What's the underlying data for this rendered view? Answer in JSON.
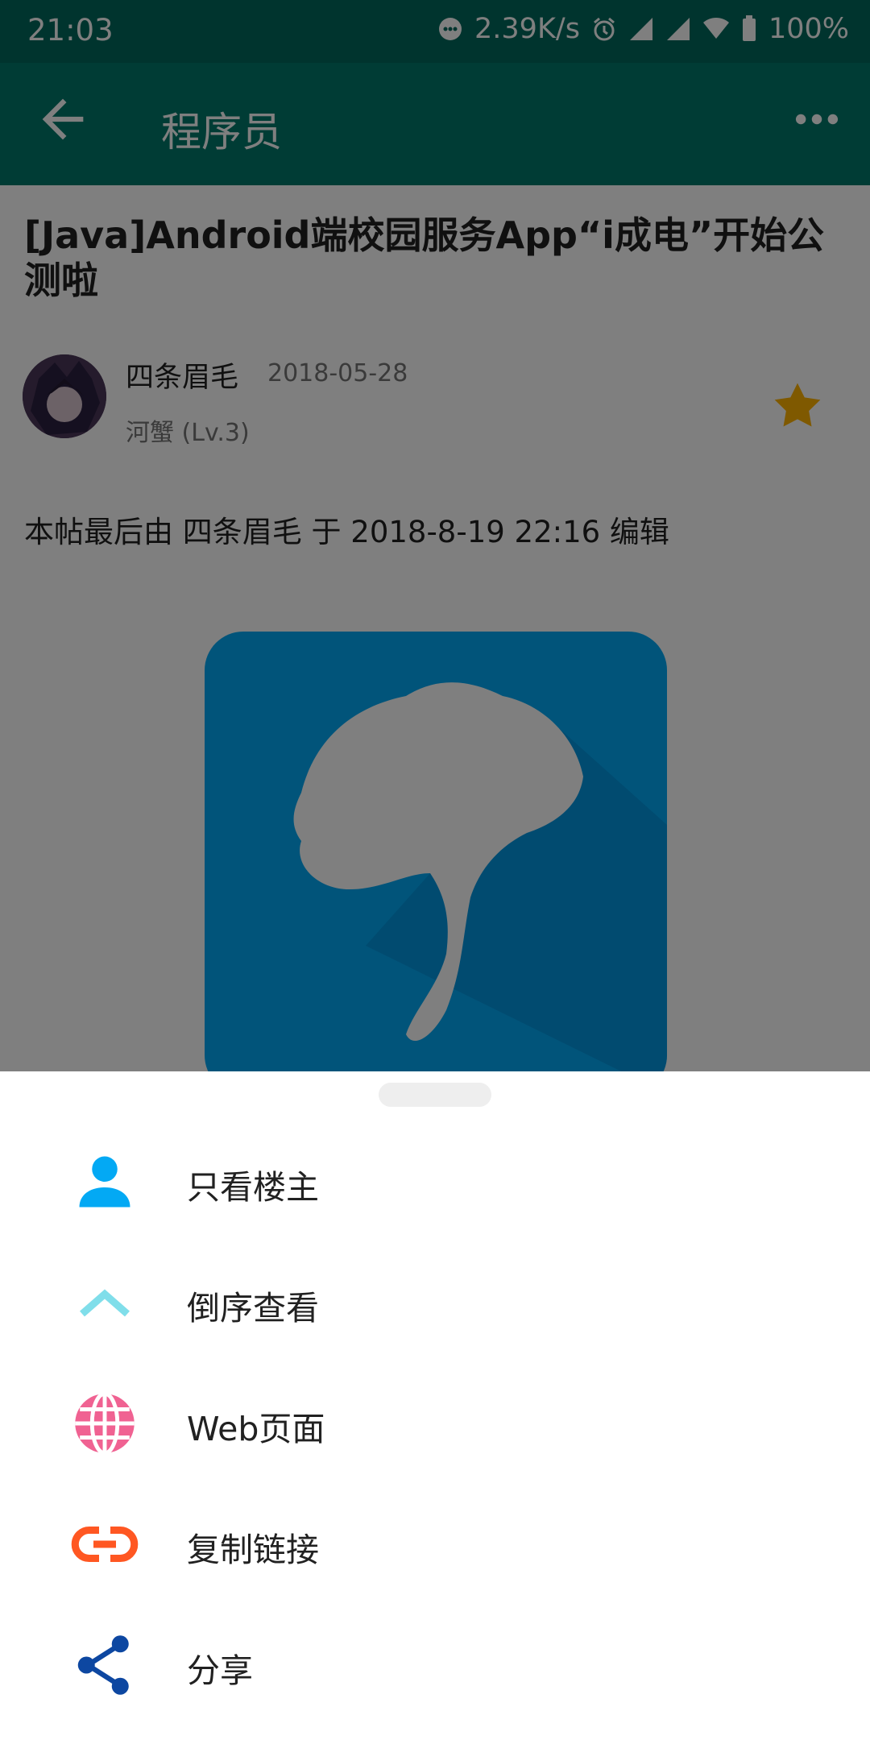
{
  "status_bar": {
    "time": "21:03",
    "net_speed": "2.39K/s",
    "battery": "100%",
    "icons": [
      "message-icon",
      "alarm-icon",
      "signal-icon",
      "signal-icon",
      "wifi-icon",
      "battery-icon"
    ]
  },
  "app_bar": {
    "title": "程序员",
    "back_icon": "arrow-back-icon",
    "more_icon": "more-horizontal-icon"
  },
  "post": {
    "title": "[Java]Android端校园服务App“i成电”开始公测啦",
    "author": "四条眉毛",
    "date": "2018-05-28",
    "level": "河蟹 (Lv.3)",
    "edit_note": "本帖最后由 四条眉毛 于 2018-8-19 22:16 编辑",
    "star_color": "#ffb300"
  },
  "sheet": {
    "items": [
      {
        "label": "只看楼主",
        "icon": "person-icon",
        "color": "#03a9f4"
      },
      {
        "label": "倒序查看",
        "icon": "chevron-up-icon",
        "color": "#80deea"
      },
      {
        "label": "Web页面",
        "icon": "globe-icon",
        "color": "#f06292"
      },
      {
        "label": "复制链接",
        "icon": "link-icon",
        "color": "#ff5722"
      },
      {
        "label": "分享",
        "icon": "share-icon",
        "color": "#0d47a1"
      }
    ]
  },
  "theme": {
    "primary": "#00796b",
    "primary_dark": "#00695c",
    "app_icon_bg": "#03a9f4"
  }
}
